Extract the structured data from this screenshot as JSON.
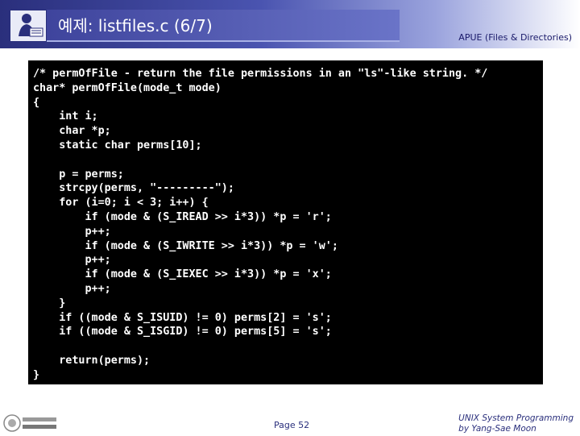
{
  "header": {
    "title": "예제: listfiles.c (6/7)",
    "subtitle": "APUE (Files & Directories)"
  },
  "code": [
    "/* permOfFile - return the file permissions in an \"ls\"-like string. */",
    "char* permOfFile(mode_t mode)",
    "{",
    "    int i;",
    "    char *p;",
    "    static char perms[10];",
    "",
    "    p = perms;",
    "    strcpy(perms, \"---------\");",
    "    for (i=0; i < 3; i++) {",
    "        if (mode & (S_IREAD >> i*3)) *p = 'r';",
    "        p++;",
    "        if (mode & (S_IWRITE >> i*3)) *p = 'w';",
    "        p++;",
    "        if (mode & (S_IEXEC >> i*3)) *p = 'x';",
    "        p++;",
    "    }",
    "    if ((mode & S_ISUID) != 0) perms[2] = 's';",
    "    if ((mode & S_ISGID) != 0) perms[5] = 's';",
    "",
    "    return(perms);",
    "}"
  ],
  "footer": {
    "page": "Page 52",
    "credit_line1": "UNIX System Programming",
    "credit_line2": "by Yang-Sae Moon"
  }
}
